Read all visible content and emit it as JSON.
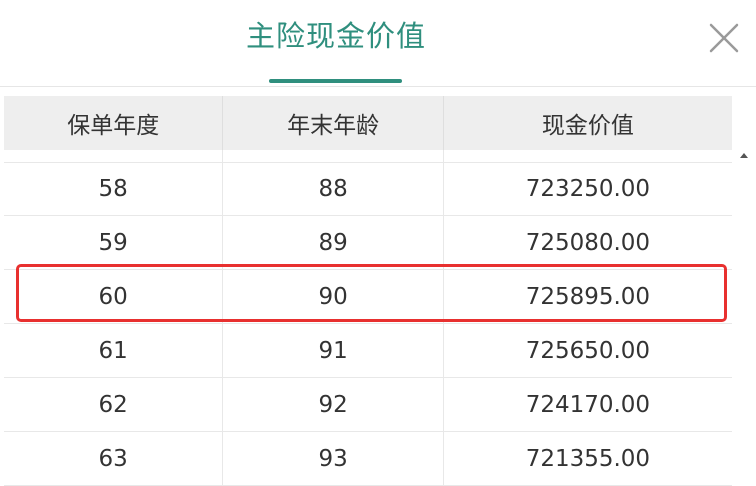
{
  "header": {
    "title": "主险现金价值"
  },
  "table": {
    "columns": [
      "保单年度",
      "年末年龄",
      "现金价值"
    ],
    "rows": [
      {
        "year": "58",
        "age": "88",
        "value": "723250.00"
      },
      {
        "year": "59",
        "age": "89",
        "value": "725080.00"
      },
      {
        "year": "60",
        "age": "90",
        "value": "725895.00"
      },
      {
        "year": "61",
        "age": "91",
        "value": "725650.00"
      },
      {
        "year": "62",
        "age": "92",
        "value": "724170.00"
      },
      {
        "year": "63",
        "age": "93",
        "value": "721355.00"
      }
    ],
    "highlighted_row_index": 2
  },
  "icons": {
    "close": "close-icon",
    "scroll_up": "scroll-up-arrow-icon"
  },
  "colors": {
    "accent": "#2f8f7e",
    "highlight": "#e8302f",
    "header_bg": "#eeeeee"
  }
}
